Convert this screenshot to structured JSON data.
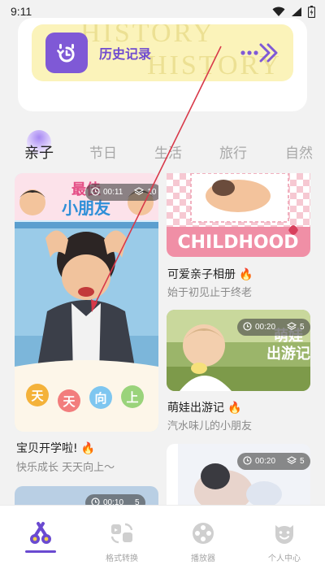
{
  "status_bar": {
    "time": "9:11"
  },
  "history": {
    "label": "历史记录",
    "watermark_top": "HISTORY",
    "watermark_bottom": "HISTORY"
  },
  "tabs": [
    {
      "label": "亲子",
      "active": true
    },
    {
      "label": "节日",
      "active": false
    },
    {
      "label": "生活",
      "active": false
    },
    {
      "label": "旅行",
      "active": false
    },
    {
      "label": "自然",
      "active": false
    }
  ],
  "cards": {
    "back_to_school": {
      "badge_time": "00:11",
      "badge_count": "10",
      "poster_title": "最佳小朋友",
      "poster_chars": [
        "天",
        "天",
        "向",
        "上"
      ],
      "title": "宝贝开学啦!",
      "subtitle": "快乐成长 天天向上～"
    },
    "parent_child_album": {
      "banner_text": "CHILDHOOD",
      "title": "可爱亲子相册",
      "subtitle": "始于初见止于终老"
    },
    "baby_travel": {
      "badge_time": "00:20",
      "badge_count": "5",
      "poster_title": "萌娃出游记",
      "title": "萌娃出游记",
      "subtitle": "汽水味儿的小朋友"
    },
    "fourth": {
      "badge_time": "00:20",
      "badge_count": "5"
    },
    "fifth": {
      "badge_time": "00:10",
      "badge_count": "5"
    }
  },
  "bottom_nav": [
    {
      "label": "",
      "icon": "scissors-icon",
      "active": true
    },
    {
      "label": "格式转换",
      "icon": "format-convert-icon",
      "active": false
    },
    {
      "label": "播放器",
      "icon": "film-reel-icon",
      "active": false
    },
    {
      "label": "个人中心",
      "icon": "smiley-icon",
      "active": false
    }
  ],
  "colors": {
    "accent_purple": "#7f59d6",
    "history_bg": "#fbf3ba",
    "fire_orange": "#f47b1e",
    "overlay_red": "#d8394a"
  }
}
